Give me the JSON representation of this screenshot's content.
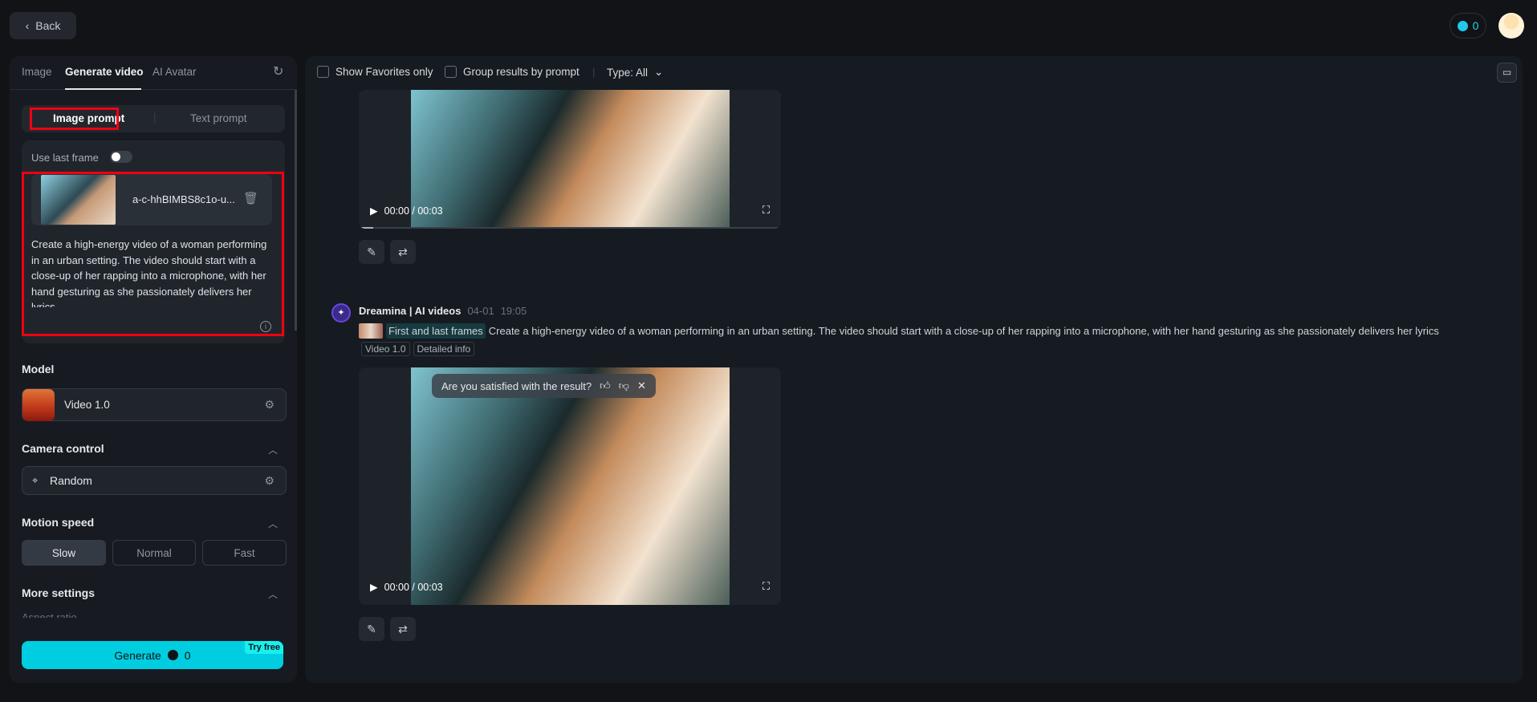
{
  "header": {
    "back_label": "Back",
    "credits": "0"
  },
  "sidebar": {
    "tabs": [
      "Image",
      "Generate video",
      "AI Avatar"
    ],
    "prompt_modes": [
      "Image prompt",
      "Text prompt"
    ],
    "use_last_frame_label": "Use last frame",
    "use_last_frame_on": false,
    "image_filename": "a-c-hhBIMBS8c1o-u...",
    "prompt_text": "Create a high-energy video of a woman performing in an urban setting. The video should start with a close-up of her rapping into a microphone, with her hand gesturing as she passionately delivers her lyrics",
    "model_label": "Model",
    "model_value": "Video 1.0",
    "camera_label": "Camera control",
    "camera_value": "Random",
    "motion_label": "Motion speed",
    "motion_options": [
      "Slow",
      "Normal",
      "Fast"
    ],
    "motion_selected": "Slow",
    "more_settings_label": "More settings",
    "aspect_ratio_label": "Aspect ratio",
    "generate_label": "Generate",
    "generate_cost": "0",
    "try_free": "Try free"
  },
  "toolbar": {
    "favorites_label": "Show Favorites only",
    "group_label": "Group results by prompt",
    "type_label": "Type: All"
  },
  "results": [
    {
      "time": "00:00 / 00:03"
    },
    {
      "author": "Dreamina | AI videos",
      "date": "04-01",
      "time_of_day": "19:05",
      "frame_mode": "First and last frames",
      "prompt": "Create a high-energy video of a woman performing in an urban setting. The video should start with a close-up of her rapping into a microphone, with her hand gesturing as she passionately delivers her lyrics",
      "tags": [
        "Video 1.0",
        "Detailed info"
      ],
      "feedback": "Are you satisfied with the result?",
      "time": "00:00 / 00:03"
    }
  ]
}
